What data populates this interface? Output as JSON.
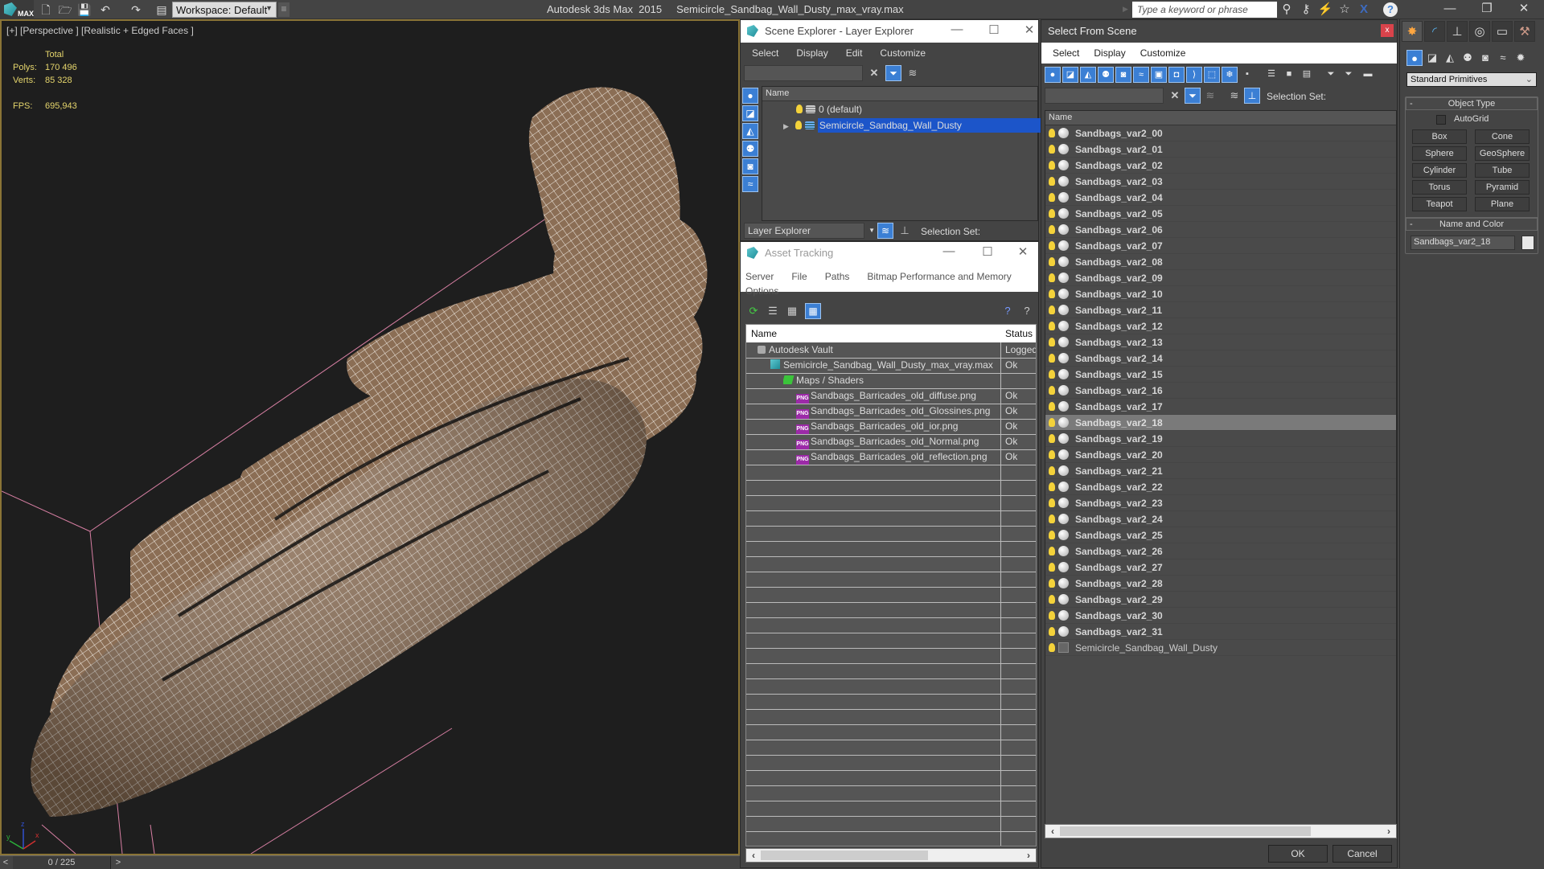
{
  "app": {
    "title": "Autodesk 3ds Max  2015     Semicircle_Sandbag_Wall_Dusty_max_vray.max",
    "logo_text": "MAX",
    "workspace": "Workspace: Default",
    "search_placeholder": "Type a keyword or phrase",
    "window_controls": {
      "minimize": "—",
      "restore": "❐",
      "close": "✕"
    }
  },
  "toolbar": {
    "icons": [
      "new-file-icon",
      "open-file-icon",
      "save-icon",
      "undo-icon",
      "redo-icon",
      "project-folder-icon"
    ],
    "right_icons": [
      "binoculars-icon",
      "key-icon",
      "satellite-icon",
      "star-icon",
      "autodesk-x-icon",
      "help-icon"
    ]
  },
  "viewport": {
    "label": "[+] [Perspective ] [Realistic + Edged Faces ]",
    "stats": {
      "header": "Total",
      "polys_label": "Polys:",
      "polys": "170 496",
      "verts_label": "Verts:",
      "verts": "85 328",
      "fps_label": "FPS:",
      "fps": "695,943"
    },
    "axis": {
      "x": "x",
      "y": "y",
      "z": "z"
    }
  },
  "timeline": {
    "prev": "<",
    "frame": "0 / 225",
    "next": ">"
  },
  "scene_explorer": {
    "title": "Scene Explorer - Layer Explorer",
    "menu": [
      "Select",
      "Display",
      "Edit",
      "Customize"
    ],
    "column": "Name",
    "layers": [
      {
        "name": "0 (default)",
        "selected": false
      },
      {
        "name": "Semicircle_Sandbag_Wall_Dusty",
        "selected": true
      }
    ],
    "footer_dropdown": "Layer Explorer",
    "selection_set_label": "Selection Set:"
  },
  "asset_tracking": {
    "title": "Asset Tracking",
    "menu": [
      "Server",
      "File",
      "Paths",
      "Bitmap Performance and Memory",
      "Options"
    ],
    "columns": [
      "Name",
      "Status"
    ],
    "rows": [
      {
        "name": "Autodesk Vault",
        "status": "Logged",
        "indent": 0,
        "icon": "vault-icon"
      },
      {
        "name": "Semicircle_Sandbag_Wall_Dusty_max_vray.max",
        "status": "Ok",
        "indent": 1,
        "icon": "max-file-icon"
      },
      {
        "name": "Maps / Shaders",
        "status": "",
        "indent": 2,
        "icon": "maps-icon"
      },
      {
        "name": "Sandbags_Barricades_old_diffuse.png",
        "status": "Ok",
        "indent": 3,
        "icon": "png-icon"
      },
      {
        "name": "Sandbags_Barricades_old_Glossines.png",
        "status": "Ok",
        "indent": 3,
        "icon": "png-icon"
      },
      {
        "name": "Sandbags_Barricades_old_ior.png",
        "status": "Ok",
        "indent": 3,
        "icon": "png-icon"
      },
      {
        "name": "Sandbags_Barricades_old_Normal.png",
        "status": "Ok",
        "indent": 3,
        "icon": "png-icon"
      },
      {
        "name": "Sandbags_Barricades_old_reflection.png",
        "status": "Ok",
        "indent": 3,
        "icon": "png-icon"
      }
    ],
    "png_badge": "PNG"
  },
  "select_from_scene": {
    "title": "Select From Scene",
    "close": "x",
    "menu": [
      "Select",
      "Display",
      "Customize"
    ],
    "selection_set_label": "Selection Set:",
    "column": "Name",
    "objects": [
      "Sandbags_var2_00",
      "Sandbags_var2_01",
      "Sandbags_var2_02",
      "Sandbags_var2_03",
      "Sandbags_var2_04",
      "Sandbags_var2_05",
      "Sandbags_var2_06",
      "Sandbags_var2_07",
      "Sandbags_var2_08",
      "Sandbags_var2_09",
      "Sandbags_var2_10",
      "Sandbags_var2_11",
      "Sandbags_var2_12",
      "Sandbags_var2_13",
      "Sandbags_var2_14",
      "Sandbags_var2_15",
      "Sandbags_var2_16",
      "Sandbags_var2_17",
      "Sandbags_var2_18",
      "Sandbags_var2_19",
      "Sandbags_var2_20",
      "Sandbags_var2_21",
      "Sandbags_var2_22",
      "Sandbags_var2_23",
      "Sandbags_var2_24",
      "Sandbags_var2_25",
      "Sandbags_var2_26",
      "Sandbags_var2_27",
      "Sandbags_var2_28",
      "Sandbags_var2_29",
      "Sandbags_var2_30",
      "Sandbags_var2_31"
    ],
    "highlighted_index": 18,
    "group": "Semicircle_Sandbag_Wall_Dusty",
    "ok": "OK",
    "cancel": "Cancel"
  },
  "command_panel": {
    "tabs": [
      "create-icon",
      "modify-icon",
      "hierarchy-icon",
      "motion-icon",
      "display-icon",
      "utilities-icon"
    ],
    "categories": [
      "geometry-icon",
      "shapes-icon",
      "lights-icon",
      "cameras-icon",
      "helpers-icon",
      "spacewarps-icon",
      "systems-icon"
    ],
    "primitive_type": "Standard Primitives",
    "object_type": {
      "title": "Object Type",
      "autogrid": "AutoGrid",
      "buttons": [
        "Box",
        "Cone",
        "Sphere",
        "GeoSphere",
        "Cylinder",
        "Tube",
        "Torus",
        "Pyramid",
        "Teapot",
        "Plane"
      ]
    },
    "name_and_color": {
      "title": "Name and Color",
      "name": "Sandbags_var2_18",
      "color": "#e8e8e8"
    }
  },
  "colors": {
    "accent_blue": "#3b7fd4",
    "selection_blue": "#1c55c9",
    "viewport_border": "#8a7436",
    "stats_yellow": "#e5d56c",
    "sandbag": "#8b6e55"
  }
}
